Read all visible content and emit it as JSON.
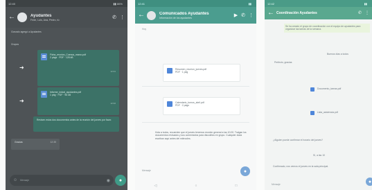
{
  "phone1": {
    "title": "Ayudantes",
    "subtitle": "Fede, Luis, Ana, Pedro, tú",
    "status_left": "12:40",
    "status_right": "▮▮ 86%",
    "system_note": "Gonzalo agregó a Ayudantes",
    "section_label": "Grupos",
    "files": [
      {
        "name": "Ficha_reunion_Cuenca_marzo.pdf",
        "meta": "2 págs · PDF · 128 kB",
        "time": "12:31"
      },
      {
        "name": "Informe_inicial_ayudantes.pdf",
        "meta": "1 pág · PDF · 96 kB",
        "time": "12:32"
      }
    ],
    "text_msg": "Revisen estos dos documentos antes de la reunión del jueves por favor.",
    "text_time": "12:33",
    "reply_label": "Gracias",
    "reply_time": "12:35",
    "input_placeholder": "Mensaje",
    "icons": {
      "back": "back-arrow-icon",
      "call": "phone-icon",
      "menu": "more-icon",
      "send": "mic-icon"
    }
  },
  "phone2": {
    "title": "Comunicados Ayudantes",
    "subtitle": "Información de los ayudantes",
    "status_left": "12:41",
    "status_right": "▮▮",
    "top_note": "Hoy",
    "cards": [
      {
        "name": "Resumen_reunion_jueves.pdf",
        "meta": "PDF · 1 pág",
        "time": "12:36"
      },
      {
        "name": "Calendario_turnos_abril.pdf",
        "meta": "PDF · 2 págs",
        "time": "12:37"
      }
    ],
    "long_msg": "Hola a todos, recuerden que el jueves tenemos reunión general a las 10:00. Traigan los documentos revisados y sus comentarios para discutirlos en grupo. Cualquier duda escriban aquí antes del miércoles.",
    "long_time": "12:40",
    "input_placeholder": "Mensaje",
    "nav": [
      "◁",
      "○",
      "□"
    ]
  },
  "phone3": {
    "title": "Coordinación Ayudantes",
    "status_left": "12:42",
    "status_right": "▮▮",
    "msgs": [
      {
        "text": "Se ha creado el grupo de coordinación con el equipo de ayudantes para organizar las tareas de la semana.",
        "time": "12:20"
      },
      {
        "text": "Buenos días a todos",
        "time": "12:21"
      },
      {
        "text": "Perfecto, gracias",
        "time": "12:24"
      },
      {
        "text": "Documento_tareas.pdf",
        "time": "12:26"
      },
      {
        "text": "Lista_asistencia.pdf",
        "time": "12:28"
      },
      {
        "text": "¿Alguien puede confirmar el horario del jueves?",
        "time": "12:30"
      },
      {
        "text": "Sí, a las 10",
        "time": "12:31"
      },
      {
        "text": "Confirmado, nos vemos el jueves en la sala principal.",
        "time": "12:33"
      }
    ],
    "input_placeholder": "Mensaje"
  }
}
